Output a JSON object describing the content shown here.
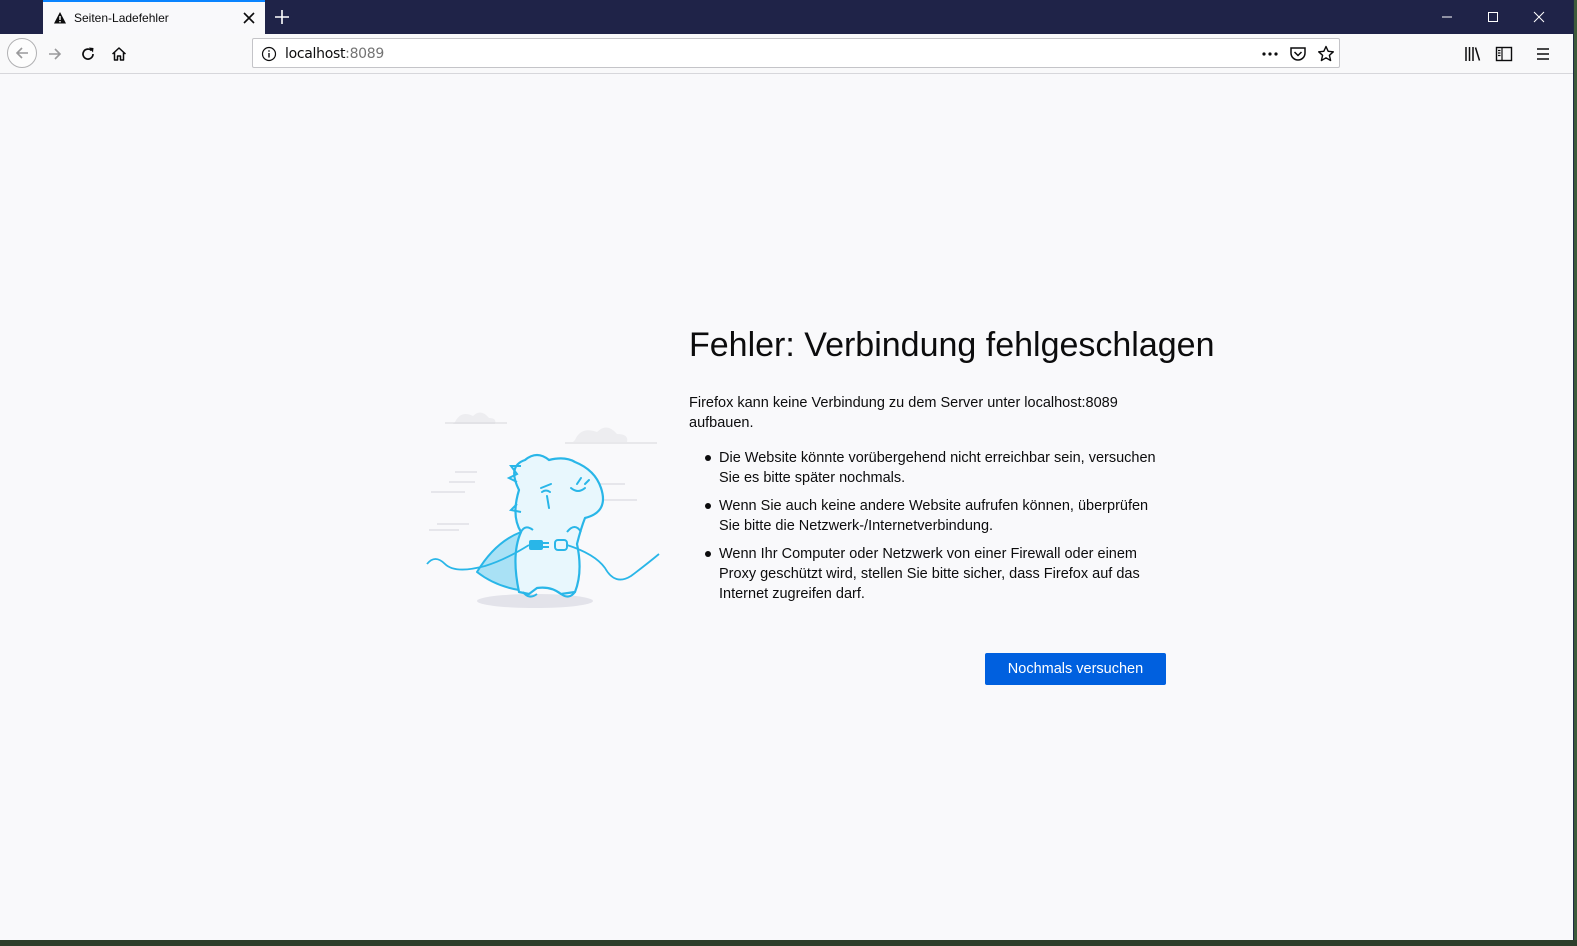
{
  "tab": {
    "title": "Seiten-Ladefehler"
  },
  "urlbar": {
    "host": "localhost",
    "port": ":8089"
  },
  "error": {
    "heading": "Fehler: Verbindung fehlgeschlagen",
    "description": "Firefox kann keine Verbindung zu dem Server unter localhost:8089 aufbauen.",
    "bullets": [
      "Die Website könnte vorübergehend nicht erreichbar sein, versuchen Sie es bitte später nochmals.",
      "Wenn Sie auch keine andere Website aufrufen können, überprüfen Sie bitte die Netzwerk-/Internetverbindung.",
      "Wenn Ihr Computer oder Netzwerk von einer Firewall oder einem Proxy geschützt wird, stellen Sie bitte sicher, dass Firefox auf das Internet zugreifen darf."
    ],
    "retry_label": "Nochmals versuchen"
  },
  "colors": {
    "accent": "#0060df",
    "tab_highlight": "#0a84ff",
    "titlebar": "#1f2348",
    "illustration": "#29b6e8"
  },
  "icons": [
    "warning-icon",
    "close-icon",
    "plus-icon",
    "minimize-icon",
    "maximize-icon",
    "back-icon",
    "forward-icon",
    "reload-icon",
    "home-icon",
    "info-icon",
    "more-icon",
    "pocket-icon",
    "star-icon",
    "library-icon",
    "sidebar-icon",
    "menu-icon"
  ]
}
